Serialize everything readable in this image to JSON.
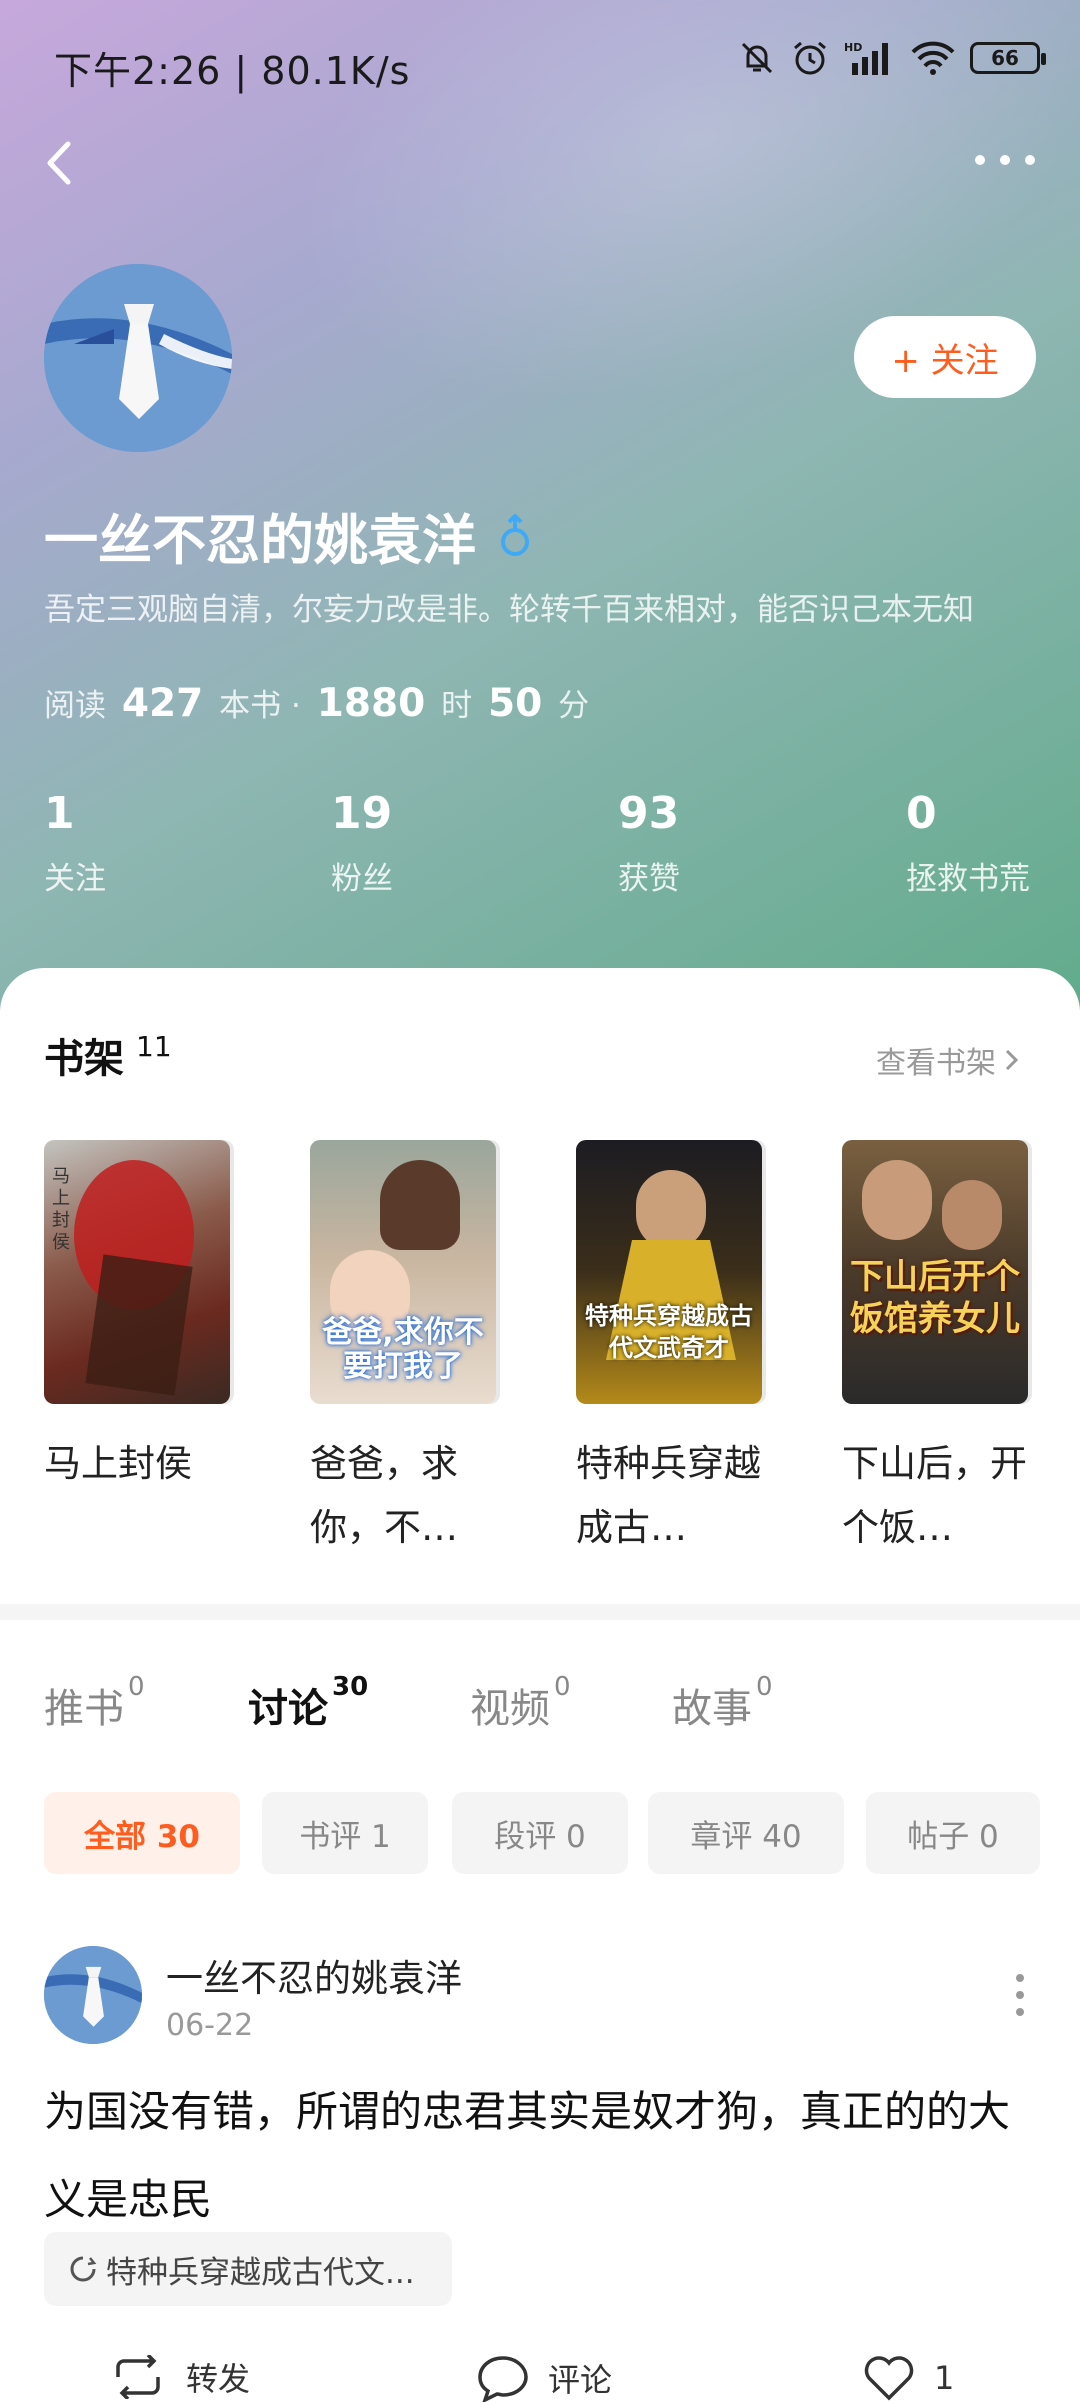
{
  "status_bar": {
    "time": "下午2:26 | 80.1K/s",
    "battery": "66"
  },
  "profile": {
    "follow_label": "+ 关注",
    "username": "一丝不忍的姚袁洋",
    "bio": "吾定三观脑自清，尔妄力改是非。轮转千百来相对，能否识己本无知",
    "reading": {
      "prefix": "阅读",
      "books": "427",
      "books_unit": "本书 ·",
      "hours": "1880",
      "hours_unit": "时",
      "minutes": "50",
      "minutes_unit": "分"
    },
    "stats": [
      {
        "num": "1",
        "label": "关注"
      },
      {
        "num": "19",
        "label": "粉丝"
      },
      {
        "num": "93",
        "label": "获赞"
      },
      {
        "num": "0",
        "label": "拯救书荒"
      }
    ]
  },
  "shelf": {
    "title": "书架",
    "count": "11",
    "link": "查看书架",
    "books": [
      {
        "title": "马上封侯",
        "cover_text": "马上封侯"
      },
      {
        "title": "爸爸，求你，不…",
        "cover_text": "爸爸,求你不要打我了"
      },
      {
        "title": "特种兵穿越成古…",
        "cover_text": "特种兵穿越成古代文武奇才"
      },
      {
        "title": "下山后，开个饭…",
        "cover_text": "下山后开个饭馆养女儿"
      }
    ]
  },
  "tabs": [
    {
      "label": "推书",
      "count": "0"
    },
    {
      "label": "讨论",
      "count": "30"
    },
    {
      "label": "视频",
      "count": "0"
    },
    {
      "label": "故事",
      "count": "0"
    }
  ],
  "filters": [
    {
      "label": "全部 30"
    },
    {
      "label": "书评 1"
    },
    {
      "label": "段评 0"
    },
    {
      "label": "章评 40"
    },
    {
      "label": "帖子 0"
    }
  ],
  "post": {
    "user": "一丝不忍的姚袁洋",
    "date": "06-22",
    "text": "为国没有错，所谓的忠君其实是奴才狗，真正的的大义是忠民",
    "book": "特种兵穿越成古代文...",
    "actions": {
      "repost": "转发",
      "comment": "评论",
      "likes": "1"
    }
  },
  "colors": {
    "accent": "#ff5d1f",
    "hero_start": "#c7a8dc",
    "hero_end": "#62ab8c"
  }
}
